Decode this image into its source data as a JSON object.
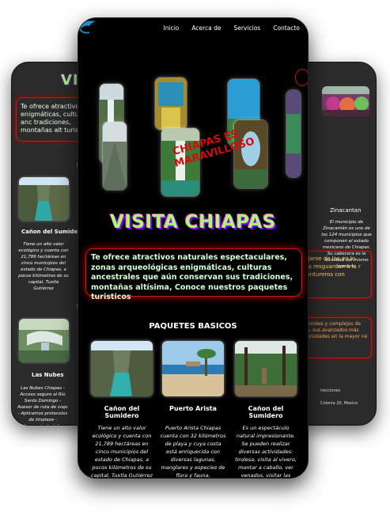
{
  "nav": {
    "items": [
      "Inicio",
      "Acerca de",
      "Servicios",
      "Contacto"
    ]
  },
  "hero": {
    "headline": "CHIAPAS ES MARAVILLOSO"
  },
  "site_title": "VISITA CHIAPAS",
  "intro": "Te ofrece atractivos naturales espectaculares, zonas arqueológicas enigmáticas, culturas ancestrales que aún conservan sus tradiciones, montañas altísima, Conoce nuestros paquetes turisticos",
  "packages": {
    "heading": "PAQUETES BASICOS",
    "items": [
      {
        "name": "Cañon del Sumidero",
        "desc": "Tiene un alto valor ecológico y cuenta con 21,789 hectáreas en cinco municipios del estado de Chiapas, a pocos kilómetros de su capital, Tuxtla Gutiérrez"
      },
      {
        "name": "Puerto Arista",
        "desc": "Puerto Arista Chiapas cuenta con 32 kilómetros de playa y cuya costa está enriquecida con diversas lagunas, manglares y especies de flora y fauna,"
      },
      {
        "name": "Cañon del Sumidero",
        "desc": "Es un espectáculo natural impresionante. Se pueden realizar diversas actividades: tirolesa, visita al vivero, montar a caballo, ver venados, visitar las grutas"
      }
    ]
  },
  "back_left": {
    "title": "VISITA",
    "intro": "Te ofrece atractivos natur enigmáticas, culturas anc tradiciones, montañas alt turisticos",
    "sub1": "PA",
    "item1_name": "Cañon del Sumidero",
    "item1_desc": "Tiene un alto valor ecológico y cuenta con 21,789 hectáreas en cinco municipios del estado de Chiapas, a pocos kilómetros de su capital, Tuxtla Gutiérrez",
    "sub2": "PA",
    "item2_name": "Las Nubes",
    "item2_desc": "Las Nubes Chiapas - Acceso seguro al Río Santo Domingo - Asesor de ruta de viaje - Aplicamos protocolos de limpieza - Información turística."
  },
  "back_right": {
    "caption": "Zinacantan",
    "desc": "El municipio de Zinacantán es uno de los 124 municipios que componen el estado mexicano de Chiapas. Su cabecera es la localidad del mismo nombre.",
    "box1": "alejarse de los en lo más resguardan a la r aventureros con",
    "box2": "pirámides y complejos de arte, sus avanzados más diversidades en la mayor né",
    "footer_label": "irecciones",
    "footer_text": "Colonia 20, Mexico"
  },
  "colors": {
    "accent_green": "#a6ff6e",
    "accent_red": "#d11515",
    "background": "#000000"
  }
}
